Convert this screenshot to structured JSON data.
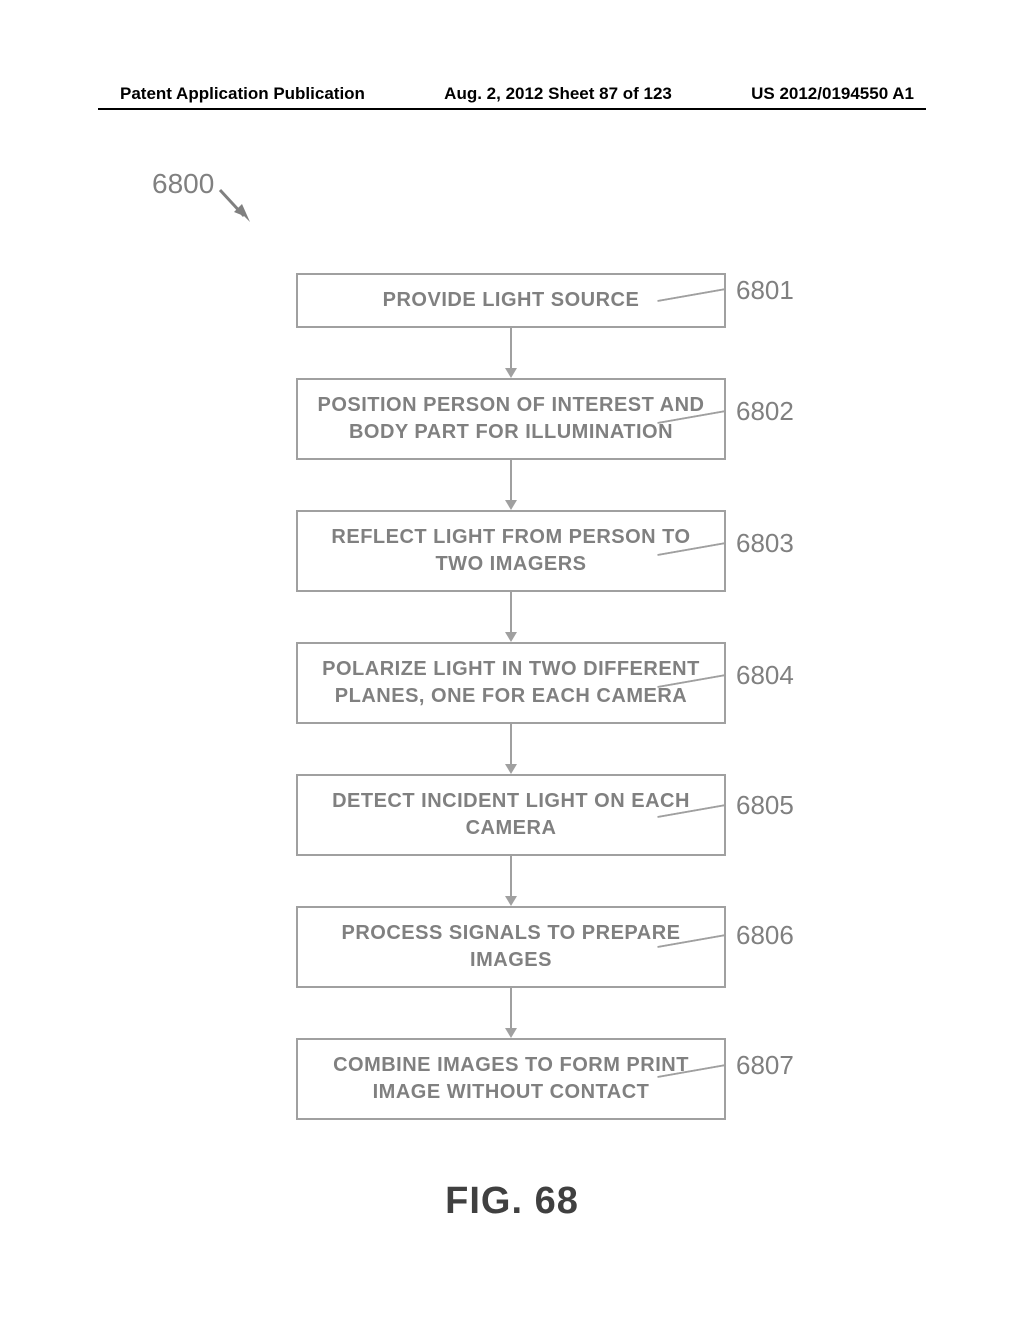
{
  "header": {
    "left": "Patent Application Publication",
    "center": "Aug. 2, 2012  Sheet 87 of 123",
    "right": "US 2012/0194550 A1"
  },
  "figure": {
    "ref": "6800",
    "caption": "FIG. 68"
  },
  "steps": [
    {
      "num": "6801",
      "text": "PROVIDE LIGHT SOURCE"
    },
    {
      "num": "6802",
      "text": "POSITION PERSON OF INTEREST AND BODY PART FOR ILLUMINATION"
    },
    {
      "num": "6803",
      "text": "REFLECT LIGHT FROM PERSON TO TWO IMAGERS"
    },
    {
      "num": "6804",
      "text": "POLARIZE LIGHT IN TWO DIFFERENT PLANES, ONE FOR EACH CAMERA"
    },
    {
      "num": "6805",
      "text": "DETECT INCIDENT LIGHT ON EACH CAMERA"
    },
    {
      "num": "6806",
      "text": "PROCESS SIGNALS TO PREPARE IMAGES"
    },
    {
      "num": "6807",
      "text": "COMBINE IMAGES TO FORM PRINT IMAGE WITHOUT CONTACT"
    }
  ]
}
